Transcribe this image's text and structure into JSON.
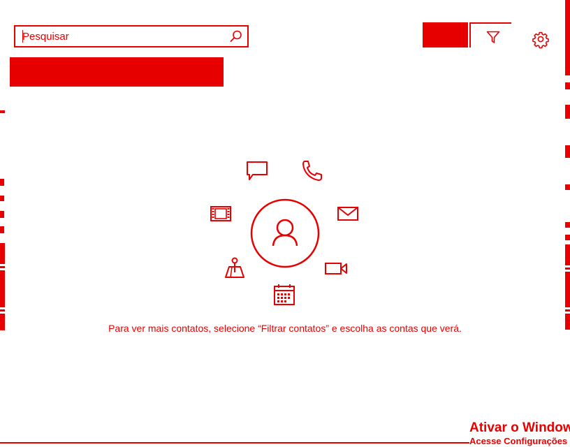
{
  "app": {
    "accent": "#e60000",
    "background": "#ffffff"
  },
  "search": {
    "placeholder": "Pesquisar",
    "value": "",
    "icon": "search-icon"
  },
  "toolbar": {
    "filter_icon": "filter-icon",
    "settings_icon": "gear-icon"
  },
  "empty_state": {
    "message": "Para ver mais contatos, selecione “Filtrar contatos” e escolha as contas que verá.",
    "icons": [
      "chat-icon",
      "phone-icon",
      "mail-icon",
      "video-call-icon",
      "calendar-icon",
      "map-pin-icon",
      "film-icon",
      "person-icon"
    ]
  },
  "watermark": {
    "title": "Ativar o Windows",
    "subtitle": "Acesse Configurações"
  }
}
